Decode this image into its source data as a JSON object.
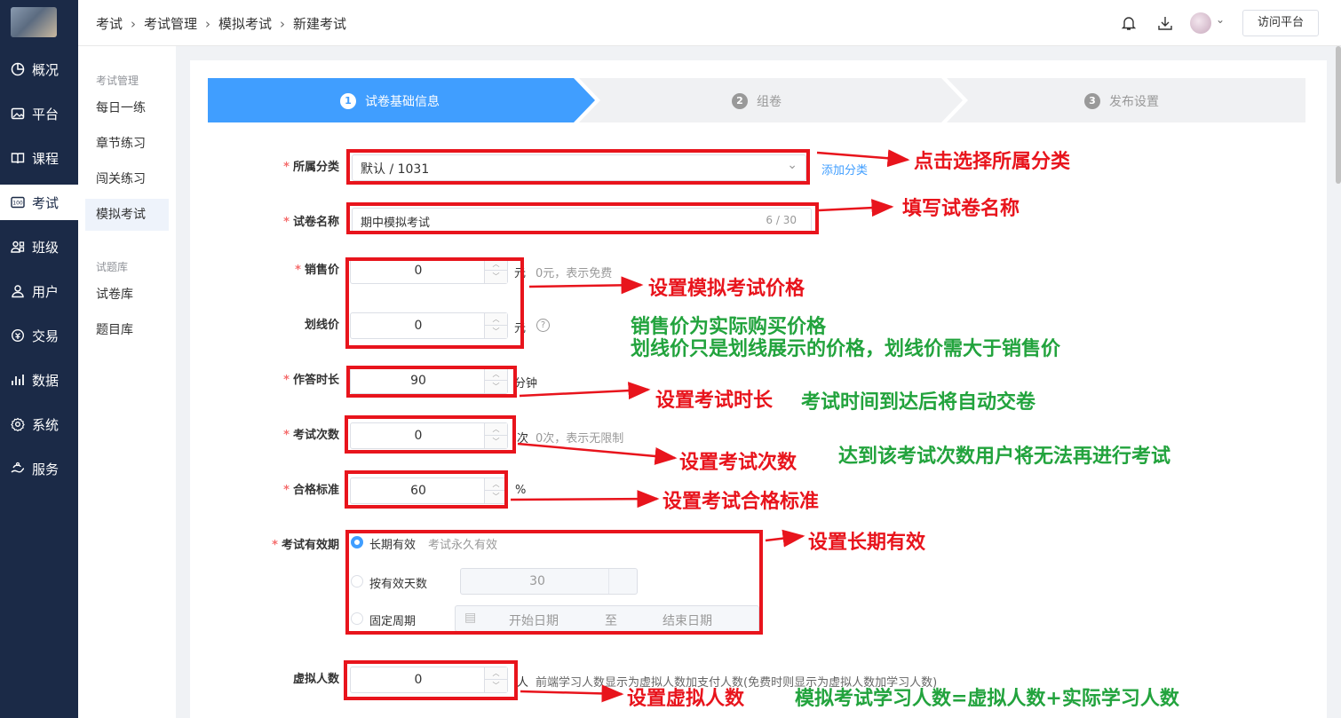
{
  "sidebar": {
    "items": [
      {
        "label": "概况",
        "icon": "pie-chart-icon"
      },
      {
        "label": "平台",
        "icon": "image-icon"
      },
      {
        "label": "课程",
        "icon": "book-icon"
      },
      {
        "label": "考试",
        "icon": "exam-icon"
      },
      {
        "label": "班级",
        "icon": "class-icon"
      },
      {
        "label": "用户",
        "icon": "user-icon"
      },
      {
        "label": "交易",
        "icon": "trade-icon"
      },
      {
        "label": "数据",
        "icon": "bar-chart-icon"
      },
      {
        "label": "系统",
        "icon": "gear-icon"
      },
      {
        "label": "服务",
        "icon": "service-icon"
      }
    ],
    "active_index": 3
  },
  "subnav": {
    "group1": "考试管理",
    "items1": [
      "每日一练",
      "章节练习",
      "闯关练习",
      "模拟考试"
    ],
    "group2": "试题库",
    "items2": [
      "试卷库",
      "题目库"
    ],
    "active": "模拟考试"
  },
  "breadcrumb": [
    "考试",
    "考试管理",
    "模拟考试",
    "新建考试"
  ],
  "header": {
    "visit_label": "访问平台"
  },
  "steps": [
    {
      "num": "1",
      "label": "试卷基础信息"
    },
    {
      "num": "2",
      "label": "组卷"
    },
    {
      "num": "3",
      "label": "发布设置"
    }
  ],
  "form": {
    "category_label": "所属分类",
    "category_value": "默认 / 1031",
    "add_category": "添加分类",
    "name_label": "试卷名称",
    "name_value": "期中模拟考试",
    "name_count": "6 / 30",
    "price_label": "销售价",
    "price_value": "0",
    "price_unit": "元",
    "price_hint": "0元，表示免费",
    "strike_label": "划线价",
    "strike_value": "0",
    "strike_unit": "元",
    "duration_label": "作答时长",
    "duration_value": "90",
    "duration_unit": "分钟",
    "attempts_label": "考试次数",
    "attempts_value": "0",
    "attempts_unit": "次",
    "attempts_hint": "0次，表示无限制",
    "pass_label": "合格标准",
    "pass_value": "60",
    "pass_unit": "%",
    "validity_label": "考试有效期",
    "validity_opt1": "长期有效",
    "validity_opt1_hint": "考试永久有效",
    "validity_opt2": "按有效天数",
    "validity_days": "30",
    "validity_opt3": "固定周期",
    "date_start": "开始日期",
    "date_to": "至",
    "date_end": "结束日期",
    "virtual_label": "虚拟人数",
    "virtual_value": "0",
    "virtual_unit": "人",
    "virtual_hint": "前端学习人数显示为虚拟人数加支付人数(免费时则显示为虚拟人数加学习人数)"
  },
  "annotations": {
    "category": "点击选择所属分类",
    "name": "填写试卷名称",
    "price": "设置模拟考试价格",
    "price_note1": "销售价为实际购买价格",
    "price_note2": "划线价只是划线展示的价格，划线价需大于销售价",
    "duration": "设置考试时长",
    "duration_note": "考试时间到达后将自动交卷",
    "attempts": "设置考试次数",
    "attempts_note": "达到该考试次数用户将无法再进行考试",
    "pass": "设置考试合格标准",
    "validity": "设置长期有效",
    "virtual": "设置虚拟人数",
    "virtual_note": "模拟考试学习人数=虚拟人数+实际学习人数"
  },
  "colors": {
    "sidebar": "#1b2a47",
    "primary": "#409eff",
    "annotation_red": "#e8141c",
    "annotation_green": "#22a33d"
  }
}
